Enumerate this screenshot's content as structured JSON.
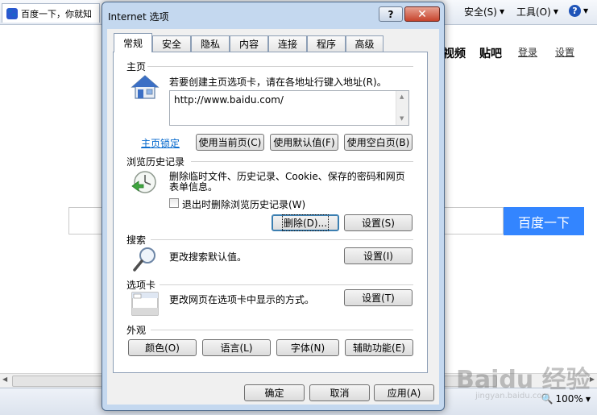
{
  "browser": {
    "tab_title": "百度一下，你就知",
    "tab_icon": "baidu-paw-icon",
    "toolbar": {
      "safety_label": "安全(S)",
      "tools_label": "工具(O)",
      "help_glyph": "?"
    },
    "page_nav": {
      "video": "视频",
      "tieba": "贴吧",
      "login": "登录",
      "settings": "设置"
    },
    "search_button": "百度一下",
    "zoom_level": "100%",
    "watermark": "Baidu 经验",
    "watermark_sub": "jingyan.baidu.com"
  },
  "dialog": {
    "title": "Internet 选项",
    "help_button": "?",
    "close_button": "✕",
    "tabs": [
      {
        "label": "常规",
        "active": true
      },
      {
        "label": "安全",
        "active": false
      },
      {
        "label": "隐私",
        "active": false
      },
      {
        "label": "内容",
        "active": false
      },
      {
        "label": "连接",
        "active": false
      },
      {
        "label": "程序",
        "active": false
      },
      {
        "label": "高级",
        "active": false
      }
    ],
    "home_page": {
      "title": "主页",
      "description": "若要创建主页选项卡，请在各地址行键入地址(R)。",
      "url_value": "http://www.baidu.com/",
      "lock_link": "主页锁定",
      "use_current": "使用当前页(C)",
      "use_default": "使用默认值(F)",
      "use_blank": "使用空白页(B)"
    },
    "history": {
      "title": "浏览历史记录",
      "description_line1": "删除临时文件、历史记录、Cookie、保存的密码和网页",
      "description_line2": "表单信息。",
      "checkbox_label": "退出时删除浏览历史记录(W)",
      "checkbox_checked": false,
      "delete_button": "删除(D)...",
      "settings_button": "设置(S)"
    },
    "search": {
      "title": "搜索",
      "description": "更改搜索默认值。",
      "settings_button": "设置(I)"
    },
    "tabs_section": {
      "title": "选项卡",
      "description": "更改网页在选项卡中显示的方式。",
      "settings_button": "设置(T)"
    },
    "appearance": {
      "title": "外观",
      "colors": "颜色(O)",
      "languages": "语言(L)",
      "fonts": "字体(N)",
      "accessibility": "辅助功能(E)"
    },
    "footer": {
      "ok": "确定",
      "cancel": "取消",
      "apply": "应用(A)"
    }
  }
}
